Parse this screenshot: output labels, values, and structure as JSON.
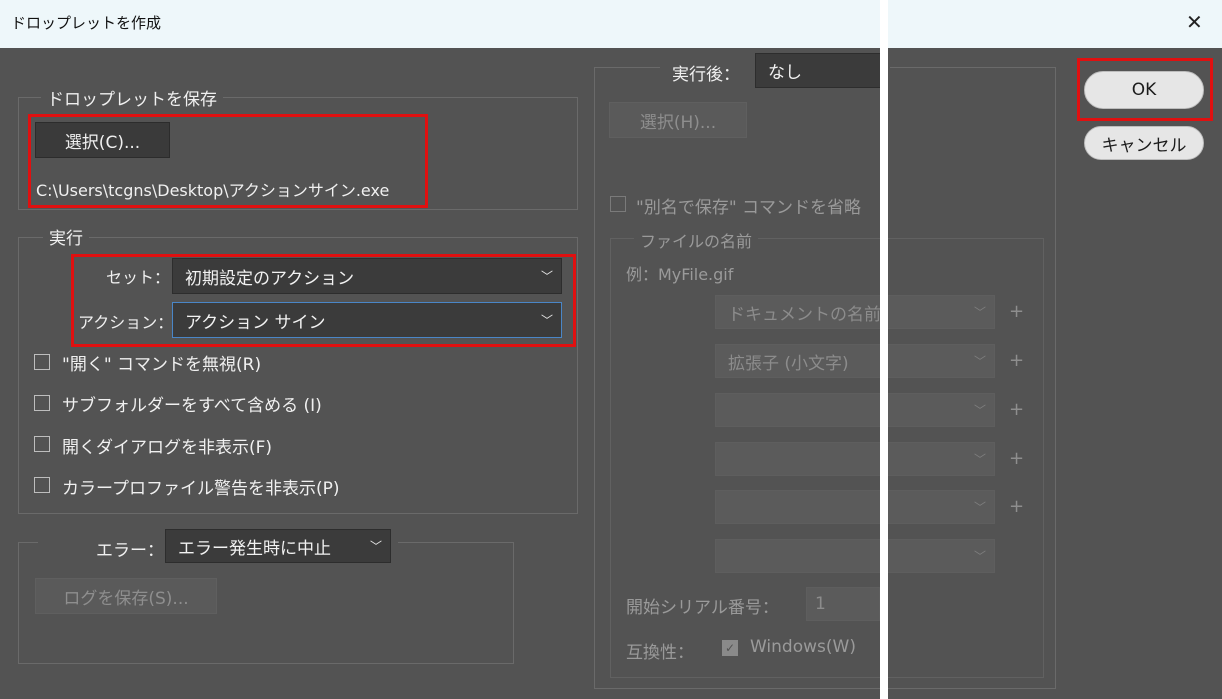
{
  "dialog": {
    "title": "ドロップレットを作成",
    "close_glyph": "✕"
  },
  "save_group": {
    "legend": "ドロップレットを保存",
    "choose_button": "選択(C)...",
    "path": "C:\\Users\\tcgns\\Desktop\\アクションサイン.exe"
  },
  "play_group": {
    "legend": "実行",
    "set_label": "セット：",
    "set_value": "初期設定のアクション",
    "action_label": "アクション：",
    "action_value": "アクション サイン",
    "checkboxes": [
      "\"開く\" コマンドを無視(R)",
      "サブフォルダーをすべて含める (I)",
      "開くダイアログを非表示(F)",
      "カラープロファイル警告を非表示(P)"
    ]
  },
  "error_group": {
    "label": "エラー：",
    "value": "エラー発生時に中止",
    "save_log_button": "ログを保存(S)..."
  },
  "destination": {
    "label": "実行後：",
    "value": "なし",
    "choose_button": "選択(H)...",
    "override_save_as": "\"別名で保存\" コマンドを省略",
    "file_naming_legend": "ファイルの名前",
    "example": "例：MyFile.gif",
    "naming_fields": [
      "ドキュメントの名前",
      "拡張子 (小文字)",
      "",
      "",
      "",
      ""
    ],
    "plus_glyph": "+",
    "serial_label": "開始シリアル番号：",
    "serial_value": "1",
    "compat_label": "互換性：",
    "windows_label": "Windows(W)"
  },
  "buttons": {
    "ok": "OK",
    "cancel": "キャンセル"
  },
  "colors": {
    "background": "#535353",
    "highlight": "#e01010",
    "focus": "#4a86c7"
  }
}
